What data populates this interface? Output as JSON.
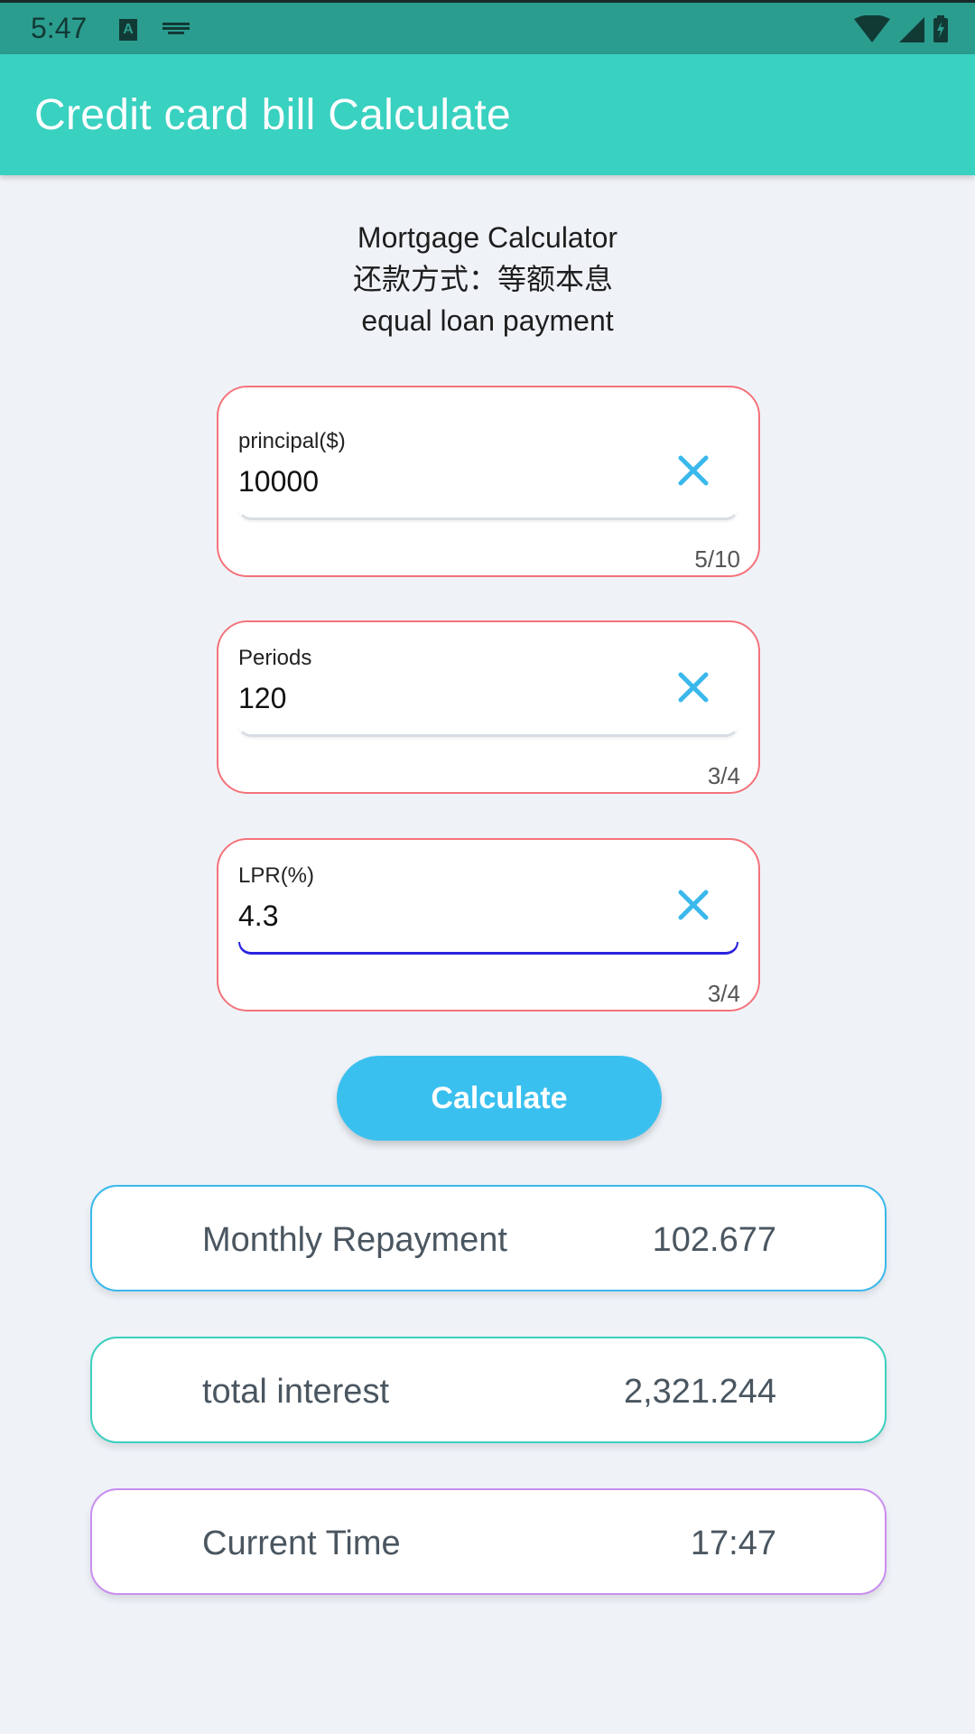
{
  "status_bar": {
    "time": "5:47",
    "icons": [
      "text-input-icon",
      "keyboard-icon",
      "wifi-icon",
      "signal-icon",
      "battery-charging-icon"
    ],
    "color": "#2b9d8f"
  },
  "app_bar": {
    "title": "Credit card bill Calculate",
    "color": "#39d1c0"
  },
  "header": {
    "title": "Mortgage Calculator",
    "method_zh": "还款方式：等额本息",
    "method_en": "equal loan payment"
  },
  "fields": [
    {
      "label": "principal($)",
      "value": "10000",
      "counter": "5/10",
      "focused": false
    },
    {
      "label": "Periods",
      "value": "120",
      "counter": "3/4",
      "focused": false
    },
    {
      "label": "LPR(%)",
      "value": "4.3",
      "counter": "3/4",
      "focused": true
    }
  ],
  "calculate_button": {
    "label": "Calculate",
    "color": "#3ac0ef"
  },
  "results": [
    {
      "label": "Monthly Repayment",
      "value": "102.677",
      "border_color": "#3ab8ec"
    },
    {
      "label": "total interest",
      "value": "2,321.244",
      "border_color": "#3dcfbf"
    },
    {
      "label": "Current Time",
      "value": "17:47",
      "border_color": "#c98ef0"
    }
  ],
  "colors": {
    "field_border": "#f4727a",
    "clear_icon": "#3ab8ec",
    "focus_underline": "#2a22e0",
    "background": "#eff3f8"
  }
}
